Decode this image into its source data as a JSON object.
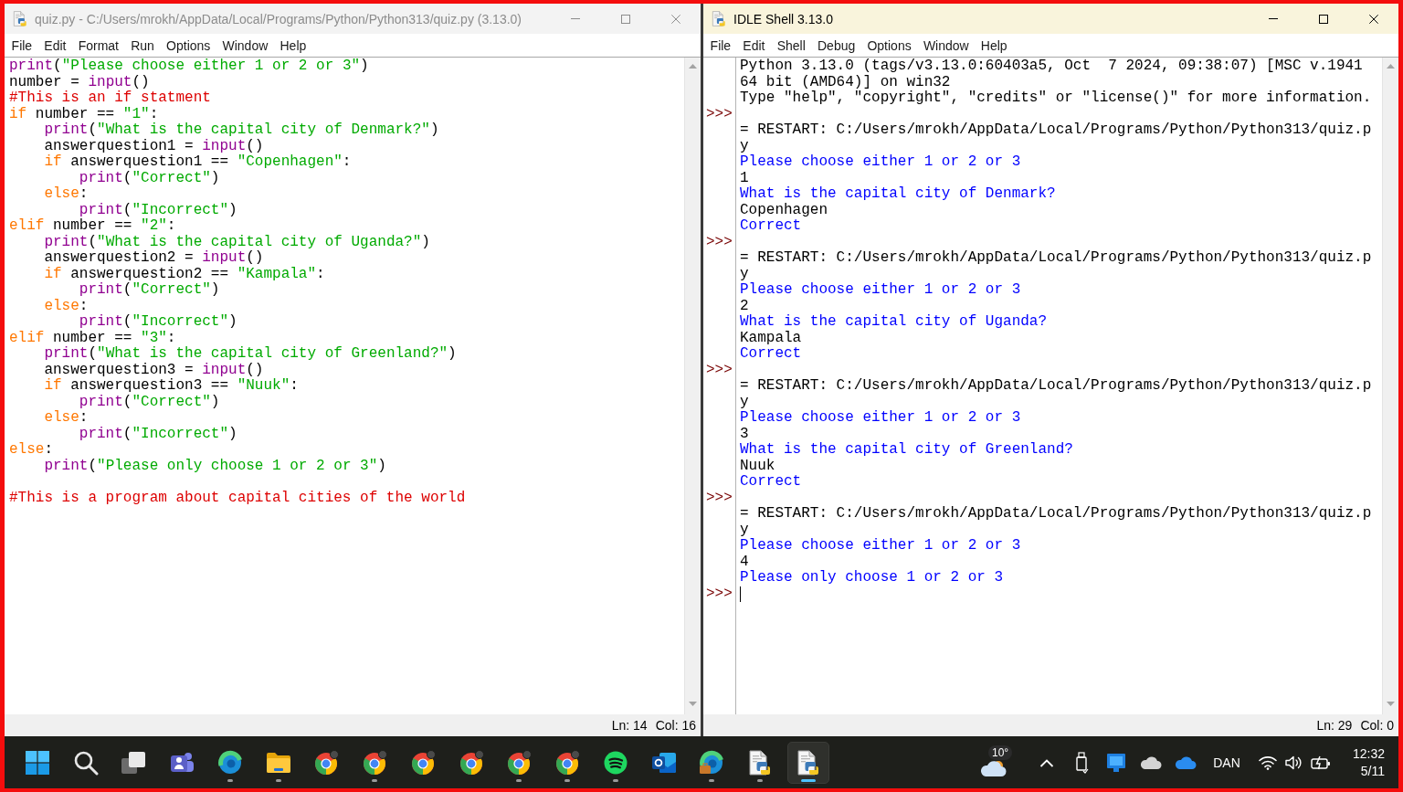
{
  "editor_window": {
    "title": "quiz.py - C:/Users/mrokh/AppData/Local/Programs/Python/Python313/quiz.py (3.13.0)",
    "active": false,
    "menu": [
      "File",
      "Edit",
      "Format",
      "Run",
      "Options",
      "Window",
      "Help"
    ],
    "code": {
      "blocks": [
        {
          "lines": [
            {
              "tokens": [
                {
                  "kind": "builtin",
                  "text": "print"
                },
                {
                  "kind": "plain",
                  "text": "("
                },
                {
                  "kind": "string",
                  "text": "\"Please choose either 1 or 2 or 3\""
                },
                {
                  "kind": "plain",
                  "text": ")"
                }
              ]
            },
            {
              "tokens": [
                {
                  "kind": "plain",
                  "text": "number = "
                },
                {
                  "kind": "builtin",
                  "text": "input"
                },
                {
                  "kind": "plain",
                  "text": "()"
                }
              ]
            },
            {
              "tokens": [
                {
                  "kind": "comment",
                  "text": "#This is an if statment"
                }
              ]
            },
            {
              "tokens": [
                {
                  "kind": "keyword",
                  "text": "if"
                },
                {
                  "kind": "plain",
                  "text": " number == "
                },
                {
                  "kind": "string",
                  "text": "\"1\""
                },
                {
                  "kind": "plain",
                  "text": ":"
                }
              ]
            },
            {
              "tokens": [
                {
                  "kind": "builtin",
                  "text": "    print"
                },
                {
                  "kind": "plain",
                  "text": "("
                },
                {
                  "kind": "string",
                  "text": "\"What is the capital city of Denmark?\""
                },
                {
                  "kind": "plain",
                  "text": ")"
                }
              ]
            },
            {
              "tokens": [
                {
                  "kind": "plain",
                  "text": "    answerquestion1 = "
                },
                {
                  "kind": "builtin",
                  "text": "input"
                },
                {
                  "kind": "plain",
                  "text": "()"
                }
              ]
            },
            {
              "tokens": [
                {
                  "kind": "keyword",
                  "text": "    if"
                },
                {
                  "kind": "plain",
                  "text": " answerquestion1 == "
                },
                {
                  "kind": "string",
                  "text": "\"Copenhagen\""
                },
                {
                  "kind": "plain",
                  "text": ":"
                }
              ]
            },
            {
              "tokens": [
                {
                  "kind": "builtin",
                  "text": "        print"
                },
                {
                  "kind": "plain",
                  "text": "("
                },
                {
                  "kind": "string",
                  "text": "\"Correct\""
                },
                {
                  "kind": "plain",
                  "text": ")"
                }
              ]
            },
            {
              "tokens": [
                {
                  "kind": "keyword",
                  "text": "    else"
                },
                {
                  "kind": "plain",
                  "text": ":"
                }
              ]
            },
            {
              "tokens": [
                {
                  "kind": "builtin",
                  "text": "        print"
                },
                {
                  "kind": "plain",
                  "text": "("
                },
                {
                  "kind": "string",
                  "text": "\"Incorrect\""
                },
                {
                  "kind": "plain",
                  "text": ")"
                }
              ]
            },
            {
              "tokens": [
                {
                  "kind": "keyword",
                  "text": "elif"
                },
                {
                  "kind": "plain",
                  "text": " number == "
                },
                {
                  "kind": "string",
                  "text": "\"2\""
                },
                {
                  "kind": "plain",
                  "text": ":"
                }
              ]
            },
            {
              "tokens": [
                {
                  "kind": "builtin",
                  "text": "    print"
                },
                {
                  "kind": "plain",
                  "text": "("
                },
                {
                  "kind": "string",
                  "text": "\"What is the capital city of Uganda?\""
                },
                {
                  "kind": "plain",
                  "text": ")"
                }
              ]
            },
            {
              "tokens": [
                {
                  "kind": "plain",
                  "text": "    answerquestion2 = "
                },
                {
                  "kind": "builtin",
                  "text": "input"
                },
                {
                  "kind": "plain",
                  "text": "()"
                }
              ]
            },
            {
              "tokens": [
                {
                  "kind": "keyword",
                  "text": "    if"
                },
                {
                  "kind": "plain",
                  "text": " answerquestion2 == "
                },
                {
                  "kind": "string",
                  "text": "\"Kampala\""
                },
                {
                  "kind": "plain",
                  "text": ":"
                }
              ]
            },
            {
              "tokens": [
                {
                  "kind": "builtin",
                  "text": "        print"
                },
                {
                  "kind": "plain",
                  "text": "("
                },
                {
                  "kind": "string",
                  "text": "\"Correct\""
                },
                {
                  "kind": "plain",
                  "text": ")"
                }
              ]
            },
            {
              "tokens": [
                {
                  "kind": "keyword",
                  "text": "    else"
                },
                {
                  "kind": "plain",
                  "text": ":"
                }
              ]
            },
            {
              "tokens": [
                {
                  "kind": "builtin",
                  "text": "        print"
                },
                {
                  "kind": "plain",
                  "text": "("
                },
                {
                  "kind": "string",
                  "text": "\"Incorrect\""
                },
                {
                  "kind": "plain",
                  "text": ")"
                }
              ]
            },
            {
              "tokens": [
                {
                  "kind": "keyword",
                  "text": "elif"
                },
                {
                  "kind": "plain",
                  "text": " number == "
                },
                {
                  "kind": "string",
                  "text": "\"3\""
                },
                {
                  "kind": "plain",
                  "text": ":"
                }
              ]
            },
            {
              "tokens": [
                {
                  "kind": "builtin",
                  "text": "    print"
                },
                {
                  "kind": "plain",
                  "text": "("
                },
                {
                  "kind": "string",
                  "text": "\"What is the capital city of Greenland?\""
                },
                {
                  "kind": "plain",
                  "text": ")"
                }
              ]
            },
            {
              "tokens": [
                {
                  "kind": "plain",
                  "text": "    answerquestion3 = "
                },
                {
                  "kind": "builtin",
                  "text": "input"
                },
                {
                  "kind": "plain",
                  "text": "()"
                }
              ]
            },
            {
              "tokens": [
                {
                  "kind": "keyword",
                  "text": "    if"
                },
                {
                  "kind": "plain",
                  "text": " answerquestion3 == "
                },
                {
                  "kind": "string",
                  "text": "\"Nuuk\""
                },
                {
                  "kind": "plain",
                  "text": ":"
                }
              ]
            },
            {
              "tokens": [
                {
                  "kind": "builtin",
                  "text": "        print"
                },
                {
                  "kind": "plain",
                  "text": "("
                },
                {
                  "kind": "string",
                  "text": "\"Correct\""
                },
                {
                  "kind": "plain",
                  "text": ")"
                }
              ]
            },
            {
              "tokens": [
                {
                  "kind": "keyword",
                  "text": "    else"
                },
                {
                  "kind": "plain",
                  "text": ":"
                }
              ]
            },
            {
              "tokens": [
                {
                  "kind": "builtin",
                  "text": "        print"
                },
                {
                  "kind": "plain",
                  "text": "("
                },
                {
                  "kind": "string",
                  "text": "\"Incorrect\""
                },
                {
                  "kind": "plain",
                  "text": ")"
                }
              ]
            },
            {
              "tokens": [
                {
                  "kind": "keyword",
                  "text": "else"
                },
                {
                  "kind": "plain",
                  "text": ":"
                }
              ]
            },
            {
              "tokens": [
                {
                  "kind": "builtin",
                  "text": "    print"
                },
                {
                  "kind": "plain",
                  "text": "("
                },
                {
                  "kind": "string",
                  "text": "\"Please only choose 1 or 2 or 3\""
                },
                {
                  "kind": "plain",
                  "text": ")"
                }
              ]
            }
          ]
        },
        {
          "lines": [
            {
              "tokens": [
                {
                  "kind": "comment",
                  "text": "#This is a program about capital cities of the world"
                }
              ]
            }
          ]
        }
      ]
    },
    "status": {
      "line": "Ln: 14",
      "column": "Col: 16"
    }
  },
  "shell_window": {
    "title": "IDLE Shell 3.13.0",
    "active": true,
    "menu": [
      "File",
      "Edit",
      "Shell",
      "Debug",
      "Options",
      "Window",
      "Help"
    ],
    "lines": [
      {
        "kind": "banner",
        "text": "Python 3.13.0 (tags/v3.13.0:60403a5, Oct  7 2024, 09:38:07) [MSC v.1941"
      },
      {
        "kind": "banner",
        "text": "64 bit (AMD64)] on win32"
      },
      {
        "kind": "banner",
        "text": "Type \"help\", \"copyright\", \"credits\" or \"license()\" for more information."
      },
      {
        "prompt": ">>>"
      },
      {
        "kind": "restart",
        "text": "= RESTART: C:/Users/mrokh/AppData/Local/Programs/Python/Python313/quiz.p"
      },
      {
        "kind": "restart",
        "text": "y"
      },
      {
        "kind": "stdout",
        "text": "Please choose either 1 or 2 or 3"
      },
      {
        "kind": "stdin",
        "text": "1"
      },
      {
        "kind": "stdout",
        "text": "What is the capital city of Denmark?"
      },
      {
        "kind": "stdin",
        "text": "Copenhagen"
      },
      {
        "kind": "stdout",
        "text": "Correct"
      },
      {
        "prompt": ">>>"
      },
      {
        "kind": "restart",
        "text": "= RESTART: C:/Users/mrokh/AppData/Local/Programs/Python/Python313/quiz.p"
      },
      {
        "kind": "restart",
        "text": "y"
      },
      {
        "kind": "stdout",
        "text": "Please choose either 1 or 2 or 3"
      },
      {
        "kind": "stdin",
        "text": "2"
      },
      {
        "kind": "stdout",
        "text": "What is the capital city of Uganda?"
      },
      {
        "kind": "stdin",
        "text": "Kampala"
      },
      {
        "kind": "stdout",
        "text": "Correct"
      },
      {
        "prompt": ">>>"
      },
      {
        "kind": "restart",
        "text": "= RESTART: C:/Users/mrokh/AppData/Local/Programs/Python/Python313/quiz.p"
      },
      {
        "kind": "restart",
        "text": "y"
      },
      {
        "kind": "stdout",
        "text": "Please choose either 1 or 2 or 3"
      },
      {
        "kind": "stdin",
        "text": "3"
      },
      {
        "kind": "stdout",
        "text": "What is the capital city of Greenland?"
      },
      {
        "kind": "stdin",
        "text": "Nuuk"
      },
      {
        "kind": "stdout",
        "text": "Correct"
      },
      {
        "prompt": ">>>"
      },
      {
        "kind": "restart",
        "text": "= RESTART: C:/Users/mrokh/AppData/Local/Programs/Python/Python313/quiz.p"
      },
      {
        "kind": "restart",
        "text": "y"
      },
      {
        "kind": "stdout",
        "text": "Please choose either 1 or 2 or 3"
      },
      {
        "kind": "stdin",
        "text": "4"
      },
      {
        "kind": "stdout",
        "text": "Please only choose 1 or 2 or 3"
      }
    ],
    "input": {
      "prompt": ">>>",
      "focused": true
    },
    "status": {
      "line": "Ln: 29",
      "column": "Col: 0"
    }
  },
  "taskbar": {
    "apps": [
      {
        "kind": "start",
        "running": false,
        "selected": false
      },
      {
        "kind": "search",
        "running": false,
        "selected": false
      },
      {
        "kind": "task-view",
        "running": false,
        "selected": false
      },
      {
        "kind": "teams",
        "running": false,
        "selected": false
      },
      {
        "kind": "edge",
        "running": true,
        "selected": false
      },
      {
        "kind": "folder",
        "running": true,
        "selected": false
      },
      {
        "kind": "chrome",
        "running": false,
        "selected": false
      },
      {
        "kind": "chrome",
        "running": true,
        "selected": false
      },
      {
        "kind": "chrome",
        "running": false,
        "selected": false
      },
      {
        "kind": "chrome",
        "running": false,
        "selected": false
      },
      {
        "kind": "chrome",
        "running": true,
        "selected": false
      },
      {
        "kind": "chrome",
        "running": true,
        "selected": false
      },
      {
        "kind": "spotify",
        "running": true,
        "selected": false
      },
      {
        "kind": "outlook",
        "running": false,
        "selected": false
      },
      {
        "kind": "edge-work",
        "running": true,
        "selected": false
      },
      {
        "kind": "python-file",
        "running": true,
        "selected": false
      },
      {
        "kind": "python-file",
        "running": true,
        "selected": true
      }
    ],
    "weather": {
      "temperature": "10°"
    },
    "tray": [
      {
        "kind": "chevron"
      },
      {
        "kind": "usb"
      },
      {
        "kind": "app"
      },
      {
        "kind": "cloud"
      },
      {
        "kind": "cloud-sync"
      }
    ],
    "language": "DAN",
    "system_icons": [
      {
        "kind": "wifi"
      },
      {
        "kind": "volume"
      },
      {
        "kind": "battery"
      }
    ],
    "clock": {
      "time": "12:32",
      "date": "5/11"
    }
  }
}
